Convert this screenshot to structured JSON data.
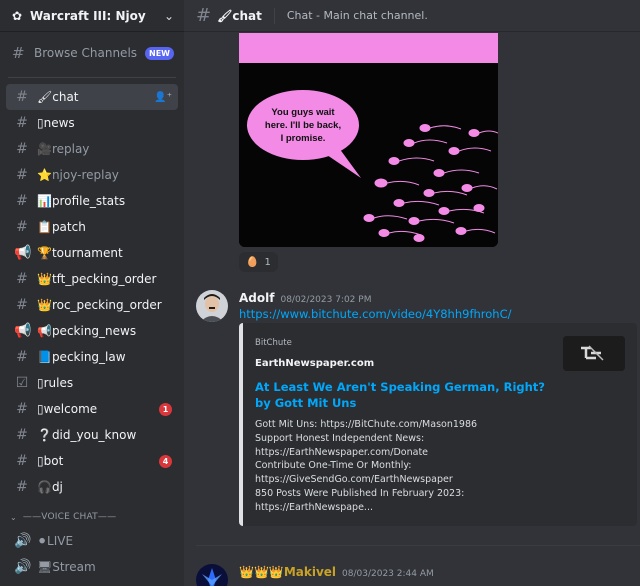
{
  "server": {
    "name": "Warcraft III: Njoy"
  },
  "browse": {
    "label": "Browse Channels",
    "badge": "NEW"
  },
  "channels": [
    {
      "name": "🖌chat",
      "icon": "#"
    },
    {
      "name": "▯news",
      "icon": "#"
    },
    {
      "name": "🎥replay",
      "icon": "#"
    },
    {
      "name": "⭐njoy-replay",
      "icon": "#"
    },
    {
      "name": "📊profile_stats",
      "icon": "#"
    },
    {
      "name": "📋patch",
      "icon": "#"
    },
    {
      "name": "🏆tournament",
      "icon": "📢"
    },
    {
      "name": "👑tft_pecking_order",
      "icon": "#"
    },
    {
      "name": "👑roc_pecking_order",
      "icon": "#"
    },
    {
      "name": "📢pecking_news",
      "icon": "📢"
    },
    {
      "name": "📘pecking_law",
      "icon": "#"
    },
    {
      "name": "▯rules",
      "icon": "☑"
    },
    {
      "name": "▯welcome",
      "icon": "#",
      "mentions": "1"
    },
    {
      "name": "❔did_you_know",
      "icon": "#"
    },
    {
      "name": "▯bot",
      "icon": "#",
      "mentions": "4"
    },
    {
      "name": "🎧dj",
      "icon": "#"
    }
  ],
  "voice_category": {
    "label": "——VOICE CHAT——"
  },
  "voice_channels": [
    {
      "name": "⚫LIVE"
    },
    {
      "name": "🖥Stream"
    }
  ],
  "header": {
    "channel": "🖌chat",
    "topic": "Chat - Main chat channel."
  },
  "meme": {
    "bubble_text": "You guys wait here. I'll be back, I promise."
  },
  "reaction": {
    "emoji": "🥚",
    "count": "1"
  },
  "message1": {
    "author": "Adolf",
    "timestamp": "08/02/2023 7:02 PM",
    "link": "https://www.bitchute.com/video/4Y8hh9fhrohC/",
    "embed": {
      "provider": "BitChute",
      "author": "EarthNewspaper.com",
      "title": "At Least We Aren't Speaking German, Right? by Gott Mit Uns",
      "description": "Gott Mit Uns: https://BitChute.com/Mason1986\nSupport Honest Independent News:\nhttps://EarthNewspaper.com/Donate\nContribute One-Time Or Monthly:\nhttps://GiveSendGo.com/EarthNewspaper\n850 Posts Were Published In February 2023:\nhttps://EarthNewspape..."
    }
  },
  "message2": {
    "author": "👑👑👑Makivel",
    "timestamp": "08/03/2023 2:44 AM"
  },
  "colors": {
    "accent": "#5865f2",
    "link": "#00a8fc",
    "mention": "#da373c",
    "meme_pink": "#f28ae6"
  }
}
